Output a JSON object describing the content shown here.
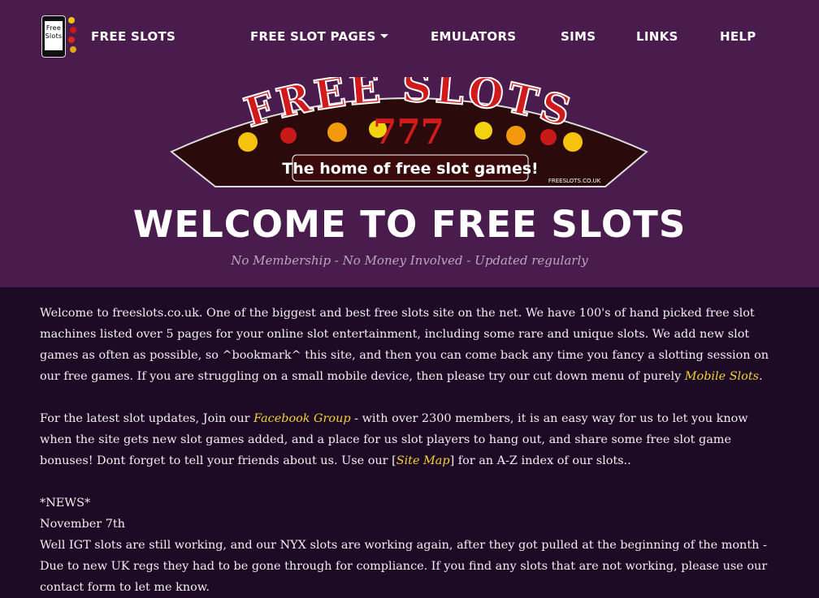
{
  "nav": {
    "brand_icon_text": "Free Slots",
    "brand_label": "FREE SLOTS",
    "items": [
      {
        "label": "FREE SLOT PAGES",
        "dropdown": true
      },
      {
        "label": "EMULATORS"
      },
      {
        "label": "SIMS"
      },
      {
        "label": "LINKS"
      },
      {
        "label": "HELP"
      }
    ]
  },
  "logo": {
    "title": "FREE SLOTS",
    "tagline": "The home of free slot games!",
    "domain": "FREESLOTS.CO.UK"
  },
  "hero": {
    "heading": "WELCOME TO FREE SLOTS",
    "subtitle": "No Membership - No Money Involved - Updated regularly"
  },
  "content": {
    "p1_text": "Welcome to freeslots.co.uk. One of the biggest and best free slots site on the net. We have 100's of  hand picked free slot machines listed over 5 pages for your online slot entertainment, including some rare and unique slots. We add new slot games as often as possible, so ^bookmark^ this site, and then you can come back any time you fancy a slotting session on our free games. If you are struggling on a small mobile device, then please try our cut down menu of purely ",
    "p1_link": "Mobile Slots",
    "p1_end": ".",
    "p2_text": "For the latest slot updates, Join our ",
    "p2_link": "Facebook Group",
    "p2_mid": " - with over 2300 members, it is an easy way for us to let you know when the site gets new slot games added, and a place for us slot players to hang out, and share some free slot game bonuses! Dont forget to tell your friends about us. Use our [",
    "p2_link2": "Site Map",
    "p2_end": "] for an A-Z index of our slots..",
    "news_label": "*NEWS*",
    "news_date": "November 7th",
    "news_text": "Well IGT slots are still working, and our NYX slots are working again, after they got pulled at the beginning of the month - Due to new UK regs they had to be gone through for compliance. If you find any slots that are not working, please use our contact form to let me know."
  },
  "colors": {
    "header_bg": "#4a1b4d",
    "body_bg": "#1d0a24",
    "link": "#f1d23b",
    "logo_red": "#d11a1a"
  }
}
